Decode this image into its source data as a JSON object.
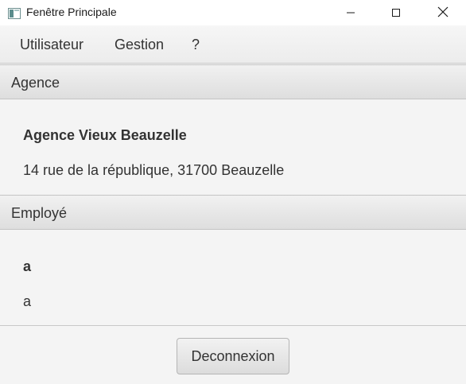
{
  "window": {
    "title": "Fenêtre Principale"
  },
  "menu": {
    "items": [
      {
        "label": "Utilisateur"
      },
      {
        "label": "Gestion"
      },
      {
        "label": "?"
      }
    ]
  },
  "agence": {
    "header": "Agence",
    "name": "Agence Vieux Beauzelle",
    "address": "14 rue de la république, 31700 Beauzelle"
  },
  "employe": {
    "header": "Employé",
    "name": "a",
    "detail": "a"
  },
  "footer": {
    "logout_label": "Deconnexion"
  },
  "colors": {
    "background": "#f4f4f4",
    "text": "#333333",
    "border": "#c4c4c4"
  }
}
